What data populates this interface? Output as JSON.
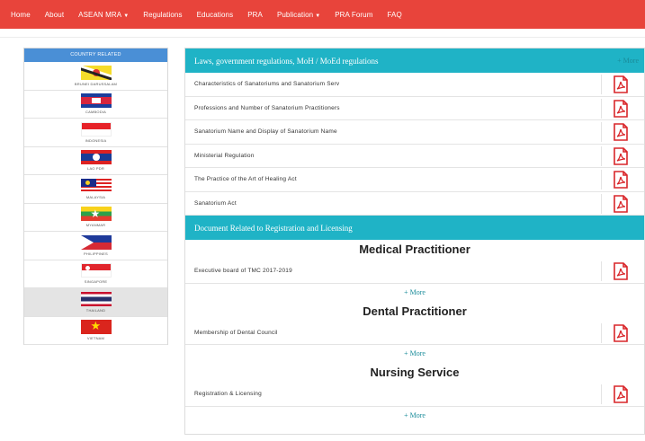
{
  "nav": {
    "items": [
      "Home",
      "About",
      "ASEAN MRA",
      "Regulations",
      "Educations",
      "PRA",
      "Publication",
      "PRA Forum",
      "FAQ"
    ]
  },
  "sidebar": {
    "title": "COUNTRY RELATED",
    "countries": [
      "BRUNEI DARUSSALAM",
      "CAMBODIA",
      "INDONESIA",
      "LAO PDR",
      "MALAYSIA",
      "MYANMAR",
      "PHILIPPINES",
      "SINGAPORE",
      "THAILAND",
      "VIETNAM"
    ],
    "selected": "THAILAND"
  },
  "laws": {
    "title": "Laws, government regulations, MoH / MoEd regulations",
    "more": "+ More",
    "docs": [
      "Characteristics of Sanatoriums and Sanatorium Serv",
      "Professions and Number of Sanatorium Practitioners",
      "Sanatorium Name and Display of Sanatorium Name",
      "Ministerial Regulation",
      "The Practice of the Art of Healing Act",
      "Sanatorium Act"
    ]
  },
  "registration": {
    "title": "Document Related to Registration and Licensing",
    "groups": [
      {
        "title": "Medical Practitioner",
        "doc": "Executive board of TMC 2017-2019",
        "more": "+ More"
      },
      {
        "title": "Dental Practitioner",
        "doc": "Membership of Dental Council",
        "more": "+ More"
      },
      {
        "title": "Nursing Service",
        "doc": "Registration & Licensing",
        "more": "+ More"
      }
    ]
  },
  "colors": {
    "nav": "#e8443b",
    "section": "#1fb3c6",
    "sidebar_head": "#4a8fd6",
    "pdf": "#d9262a"
  }
}
